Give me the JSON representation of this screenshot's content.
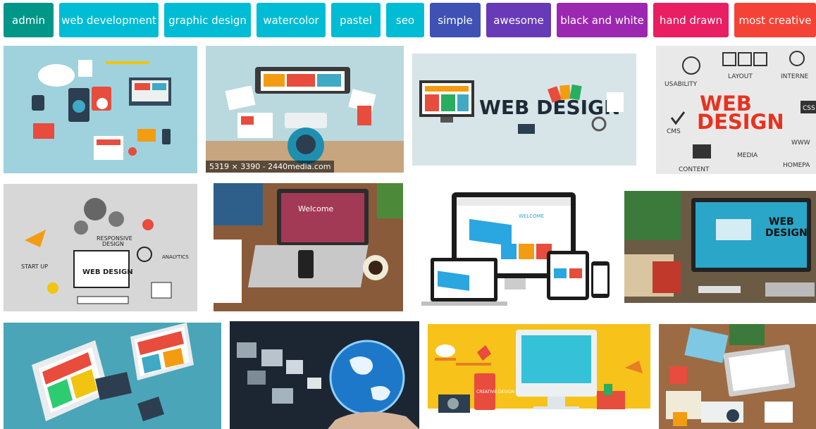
{
  "tags": [
    {
      "label": "admin",
      "color": "#009688"
    },
    {
      "label": "web development",
      "color": "#00bcd4"
    },
    {
      "label": "graphic design",
      "color": "#00bcd4"
    },
    {
      "label": "watercolor",
      "color": "#00bcd4"
    },
    {
      "label": "pastel",
      "color": "#00bcd4"
    },
    {
      "label": "seo",
      "color": "#00bcd4"
    },
    {
      "label": "simple",
      "color": "#3f51b5"
    },
    {
      "label": "awesome",
      "color": "#673ab7"
    },
    {
      "label": "black and white",
      "color": "#9c27b0"
    },
    {
      "label": "hand drawn",
      "color": "#e91e63"
    },
    {
      "label": "most creative",
      "color": "#f44336"
    }
  ],
  "images": {
    "img2_caption": "5319 × 3390 - 2440media.com",
    "img3_text": "WEB DESIGN",
    "img4_text1": "WEB",
    "img4_text2": "DESIGN",
    "img4_labels": [
      "USABILITY",
      "LAYOUT",
      "INTERNE",
      "CMS",
      "CSS",
      "CONTENT",
      "MEDIA",
      "WWW",
      "HOMEPA"
    ],
    "img5_labels": [
      "RESPONSIVE",
      "DESIGN",
      "ANALYTICS",
      "START UP",
      "WEB DESIGN"
    ],
    "img6_screen": "Welcome",
    "img7_screen": "WELCOME",
    "img8_text1": "WEB",
    "img8_text2": "DESIGN",
    "img15_screen": "CREATIVE DESIGN"
  }
}
